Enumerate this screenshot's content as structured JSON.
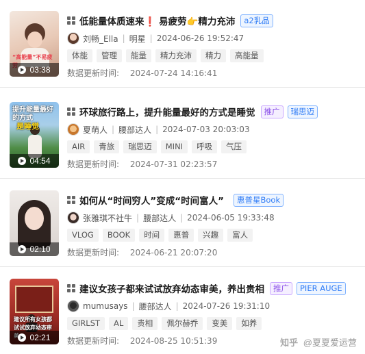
{
  "posts": [
    {
      "title": "低能量体质速来❗ 易疲劳👉精力充沛",
      "badges": [
        {
          "text": "a2乳品"
        }
      ],
      "author": "刘畅_Ella",
      "author_type": "明星",
      "publish_time": "2024-06-26 19:52:47",
      "tags": [
        "体能",
        "管理",
        "能量",
        "精力充沛",
        "精力",
        "高能量"
      ],
      "update_label": "数据更新时间:",
      "update_time": "2024-07-24 14:16:41",
      "duration": "03:38",
      "thumb_text": "“高能量”不易疲劳",
      "thumb_colors": [
        "#f1ded2",
        "#c9a38d"
      ]
    },
    {
      "title": "环球旅行路上，提升能量最好的方式是睡觉",
      "badges": [
        {
          "text": "推广"
        },
        {
          "text": "瑞思迈"
        }
      ],
      "author": "夏萌人",
      "author_type": "腰部达人",
      "publish_time": "2024-07-03 20:03:03",
      "tags": [
        "AIR",
        "青旅",
        "瑞思迈",
        "MINI",
        "呼吸",
        "气压"
      ],
      "update_label": "数据更新时间:",
      "update_time": "2024-07-31 02:23:57",
      "duration": "04:54",
      "thumb_text": "提升能量最好的方式",
      "thumb_text2": "是睡觉",
      "thumb_colors": [
        "#7fb3e0",
        "#3f7a3a"
      ]
    },
    {
      "title": "如何从“时间穷人”变成“时间富人”",
      "badges": [
        {
          "text": "惠普星Book"
        }
      ],
      "author": "张雅琪不社牛",
      "author_type": "腰部达人",
      "publish_time": "2024-06-05 19:33:48",
      "tags": [
        "VLOG",
        "BOOK",
        "时间",
        "惠普",
        "兴趣",
        "富人"
      ],
      "update_label": "数据更新时间:",
      "update_time": "2024-06-21 20:07:20",
      "duration": "02:10",
      "thumb_colors": [
        "#e9e4e2",
        "#3a2e2a"
      ]
    },
    {
      "title": "建议女孩子都来试试放弃幼态审美，养出贵相",
      "badges": [
        {
          "text": "推广"
        },
        {
          "text": "PIER AUGE"
        }
      ],
      "author": "mumusays",
      "author_type": "腰部达人",
      "publish_time": "2024-07-26 19:31:10",
      "tags": [
        "GIRLST",
        "AL",
        "贵相",
        "佩尔赫乔",
        "变美",
        "如养"
      ],
      "update_label": "数据更新时间:",
      "update_time": "2024-08-25 10:51:39",
      "duration": "02:21",
      "thumb_text": "建议所有女孩都试试放弃幼态审美",
      "thumb_colors": [
        "#b2342c",
        "#5a1410"
      ]
    }
  ],
  "watermark": {
    "platform": "知乎",
    "handle": "@夏夏爱运营"
  }
}
